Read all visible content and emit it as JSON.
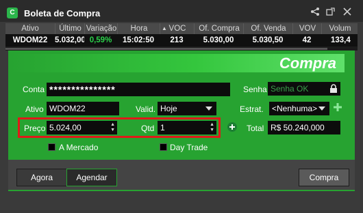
{
  "window": {
    "title": "Boleta de Compra",
    "app_icon": "C"
  },
  "quote": {
    "headers": [
      "Ativo",
      "Último",
      "Variação",
      "Hora",
      "VOC",
      "Of. Compra",
      "Of. Venda",
      "VOV",
      "Volum"
    ],
    "values": [
      "WDOM22",
      "5.032,00",
      "0,59%",
      "15:02:50",
      "213",
      "5.030,00",
      "5.030,50",
      "42",
      "133,4"
    ],
    "variation_color": "#2bd14a"
  },
  "banner": {
    "text": "Compra"
  },
  "form": {
    "conta_label": "Conta",
    "conta_value": "***************",
    "senha_label": "Senha",
    "senha_placeholder": "Senha OK",
    "ativo_label": "Ativo",
    "ativo_value": "WDOM22",
    "valid_label": "Valid.",
    "valid_value": "Hoje",
    "estrat_label": "Estrat.",
    "estrat_value": "<Nenhuma>",
    "preco_label": "Preço",
    "preco_value": "5.024,00",
    "qtd_label": "Qtd",
    "qtd_value": "1",
    "total_label": "Total",
    "total_value": "R$ 50.240,000",
    "a_mercado_label": "A Mercado",
    "day_trade_label": "Day Trade"
  },
  "footer": {
    "agora_label": "Agora",
    "agendar_label": "Agendar",
    "compra_label": "Compra"
  },
  "colors": {
    "accent": "#27a331",
    "highlight": "#e01919"
  }
}
